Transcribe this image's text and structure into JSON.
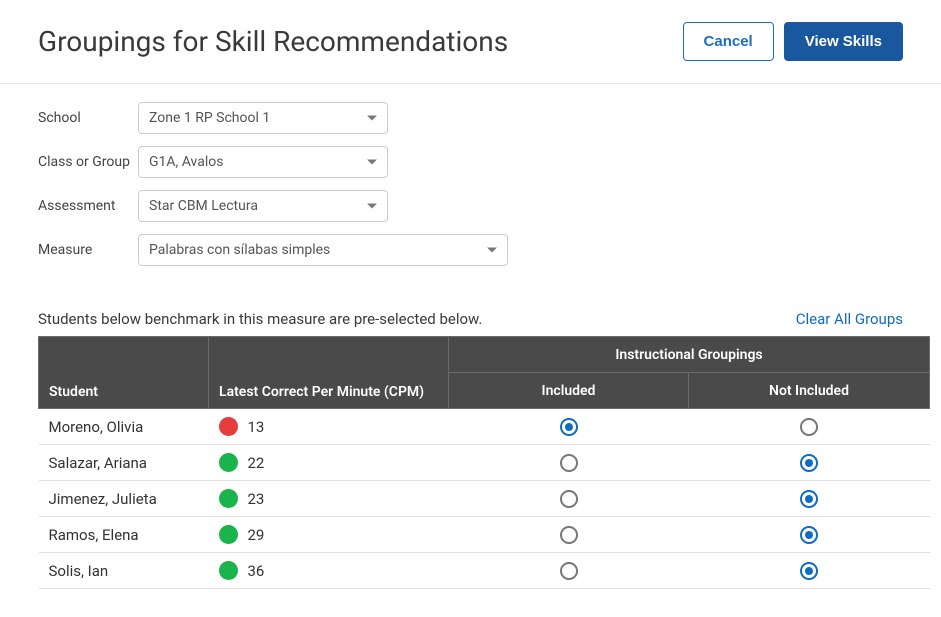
{
  "header": {
    "title": "Groupings for Skill Recommendations",
    "cancel_label": "Cancel",
    "view_label": "View Skills"
  },
  "filters": {
    "school": {
      "label": "School",
      "value": "Zone 1 RP School 1"
    },
    "class": {
      "label": "Class or Group",
      "value": "G1A, Avalos"
    },
    "assessment": {
      "label": "Assessment",
      "value": "Star CBM Lectura"
    },
    "measure": {
      "label": "Measure",
      "value": "Palabras con sílabas simples"
    }
  },
  "subhead": {
    "text": "Students below benchmark in this measure are pre-selected below.",
    "clear_link": "Clear All Groups"
  },
  "columns": {
    "student": "Student",
    "cpm": "Latest Correct Per Minute (CPM)",
    "group_head": "Instructional Groupings",
    "included": "Included",
    "not_included": "Not Included"
  },
  "status_colors": {
    "red": "#e73c3c",
    "green": "#1bb34c"
  },
  "rows": [
    {
      "name": "Moreno, Olivia",
      "cpm": "13",
      "status": "red",
      "included": true
    },
    {
      "name": "Salazar, Ariana",
      "cpm": "22",
      "status": "green",
      "included": false
    },
    {
      "name": "Jimenez, Julieta",
      "cpm": "23",
      "status": "green",
      "included": false
    },
    {
      "name": "Ramos, Elena",
      "cpm": "29",
      "status": "green",
      "included": false
    },
    {
      "name": "Solis, Ian",
      "cpm": "36",
      "status": "green",
      "included": false
    }
  ]
}
